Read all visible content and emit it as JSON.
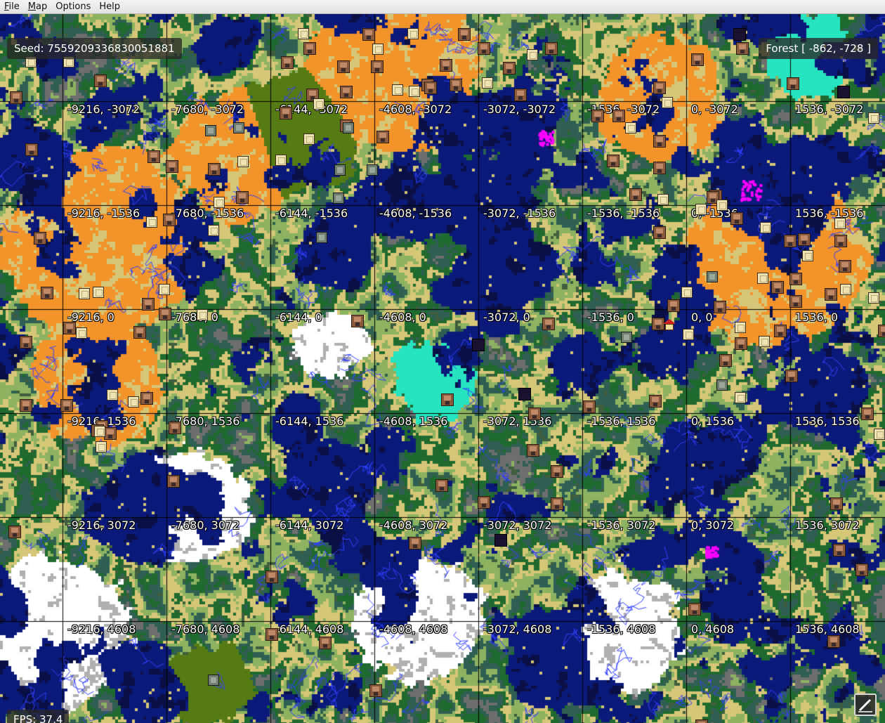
{
  "menu": {
    "items": [
      {
        "label": "File",
        "mnemonic": "F",
        "rest": "ile"
      },
      {
        "label": "Map",
        "mnemonic": "M",
        "rest": "ap"
      },
      {
        "label": "Options",
        "mnemonic": "",
        "rest": "Options"
      },
      {
        "label": "Help",
        "mnemonic": "",
        "rest": "Help"
      }
    ]
  },
  "overlay": {
    "seed_text": "Seed: 7559209336830051881",
    "biome_text": "Forest [ -862, -728 ]",
    "fps_text": "FPS: 37,4"
  },
  "grid_labels": [
    "-9216, -3072",
    "-7680, -3072",
    "-6144, -3072",
    "-4608, -3072",
    "-3072, -3072",
    "-1536, -3072",
    "0, -3072",
    "1536, -3072",
    "-9216, -1536",
    "-7680, -1536",
    "-6144, -1536",
    "-4608, -1536",
    "-3072, -1536",
    "-1536, -1536",
    "0, -1536",
    "1536, -1536",
    "-9216, 0",
    "-7680, 0",
    "-6144, 0",
    "-4608, 0",
    "-3072, 0",
    "-1536, 0",
    "0, 0",
    "1536, 0",
    "-9216, 1536",
    "-7680, 1536",
    "-6144, 1536",
    "-4608, 1536",
    "-3072, 1536",
    "-1536, 1536",
    "0, 1536",
    "1536, 1536",
    "-9216, 3072",
    "-7680, 3072",
    "-6144, 3072",
    "-4608, 3072",
    "-3072, 3072",
    "-1536, 3072",
    "0, 3072",
    "1536, 3072",
    "-9216, 4608",
    "-7680, 4608",
    "-6144, 4608",
    "-4608, 4608",
    "-3072, 4608",
    "-1536, 4608",
    "0, 4608",
    "1536, 4608"
  ],
  "colors": {
    "ocean": "#0b1a7a",
    "deep_ocean": "#0a1046",
    "forest": "#1f6a2e",
    "plains": "#8db360",
    "mountains": "#6e6e6e",
    "taiga": "#2f5f52",
    "jungle": "#567a14",
    "savanna": "#d6c678",
    "badlands": "#f2942a",
    "ice": "#ffffff",
    "warm_ocean": "#27e4c0",
    "mushroom": "#ff00ff",
    "river": "#3040ff",
    "gridline": "#000000"
  },
  "legend_icons": [
    "village-icon",
    "temple-icon",
    "stronghold-icon",
    "monument-icon",
    "spawn-icon"
  ]
}
